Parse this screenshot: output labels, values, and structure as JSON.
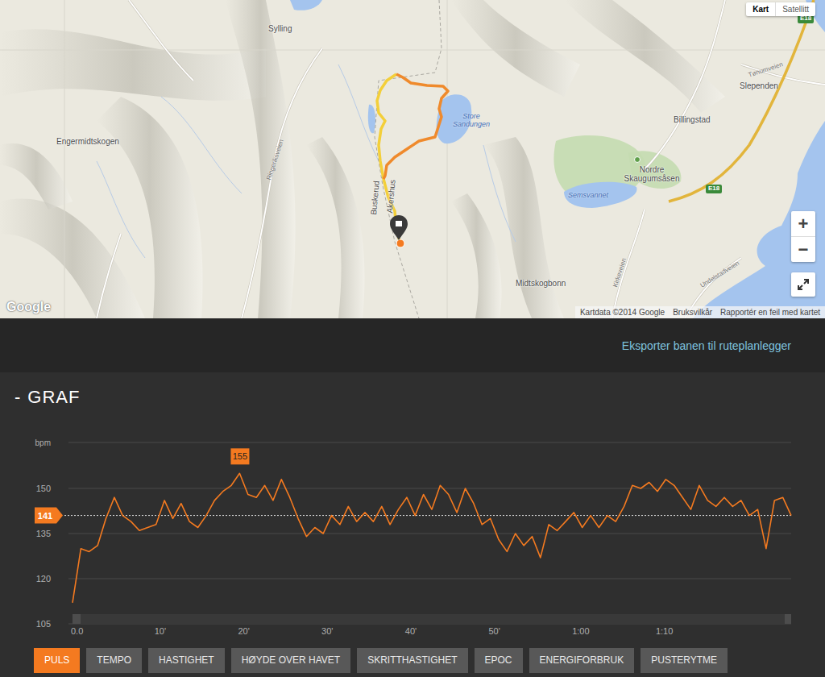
{
  "map": {
    "view_toggle": [
      {
        "label": "Kart",
        "selected": true
      },
      {
        "label": "Satellitt",
        "selected": false
      }
    ],
    "zoom_in": "+",
    "zoom_out": "−",
    "logo": "Google",
    "attribution": [
      "Kartdata ©2014 Google",
      "Bruksvilkår",
      "Rapportér en feil med kartet"
    ],
    "labels": [
      {
        "text": "Sylling",
        "kind": "place"
      },
      {
        "text": "Engermidtskogen",
        "kind": "place"
      },
      {
        "text": "Store Sandungen",
        "kind": "water"
      },
      {
        "text": "Buskerud",
        "kind": "place"
      },
      {
        "text": "Akershus",
        "kind": "place"
      },
      {
        "text": "Semsvannet",
        "kind": "water"
      },
      {
        "text": "Nordre Skaugumsåsen",
        "kind": "place"
      },
      {
        "text": "Billingstad",
        "kind": "place"
      },
      {
        "text": "Slependen",
        "kind": "place"
      },
      {
        "text": "Tønumveien",
        "kind": "road"
      },
      {
        "text": "Midtskogbonn",
        "kind": "place"
      },
      {
        "text": "E18",
        "kind": "shield"
      },
      {
        "text": "E18",
        "kind": "shield"
      },
      {
        "text": "Kirkeveien",
        "kind": "road"
      },
      {
        "text": "Ringeriksveien",
        "kind": "road"
      },
      {
        "text": "Undelstadveien",
        "kind": "road"
      }
    ]
  },
  "export_link": "Eksporter banen til ruteplanlegger",
  "graph": {
    "collapse": "-",
    "title": "GRAF",
    "unit": "bpm",
    "y_ticks": [
      "150",
      "135",
      "120",
      "105"
    ],
    "x_ticks": [
      "0.0",
      "10'",
      "20'",
      "30'",
      "40'",
      "50'",
      "1:00",
      "1:10"
    ],
    "average": "141",
    "max": "155",
    "series": {
      "name": "PULS",
      "color": "#f47a20",
      "values": [
        112,
        130,
        129,
        131,
        140,
        147,
        141,
        139,
        136,
        137,
        138,
        146,
        140,
        145,
        139,
        137,
        141,
        146,
        149,
        151,
        155,
        148,
        147,
        151,
        146,
        153,
        147,
        140,
        134,
        137,
        135,
        141,
        138,
        144,
        139,
        142,
        139,
        144,
        138,
        143,
        147,
        141,
        148,
        143,
        151,
        148,
        142,
        150,
        145,
        138,
        140,
        133,
        129,
        135,
        131,
        134,
        127,
        138,
        136,
        139,
        142,
        137,
        141,
        137,
        141,
        139,
        144,
        151,
        150,
        152,
        149,
        153,
        151,
        147,
        143,
        151,
        146,
        144,
        147,
        144,
        146,
        141,
        143,
        130,
        146,
        147,
        141
      ]
    }
  },
  "tabs": [
    {
      "label": "PULS",
      "selected": true
    },
    {
      "label": "TEMPO",
      "selected": false
    },
    {
      "label": "HASTIGHET",
      "selected": false
    },
    {
      "label": "HØYDE OVER HAVET",
      "selected": false
    },
    {
      "label": "SKRITTHASTIGHET",
      "selected": false
    },
    {
      "label": "EPOC",
      "selected": false
    },
    {
      "label": "ENERGIFORBRUK",
      "selected": false
    },
    {
      "label": "PUSTERYTME",
      "selected": false
    }
  ]
}
